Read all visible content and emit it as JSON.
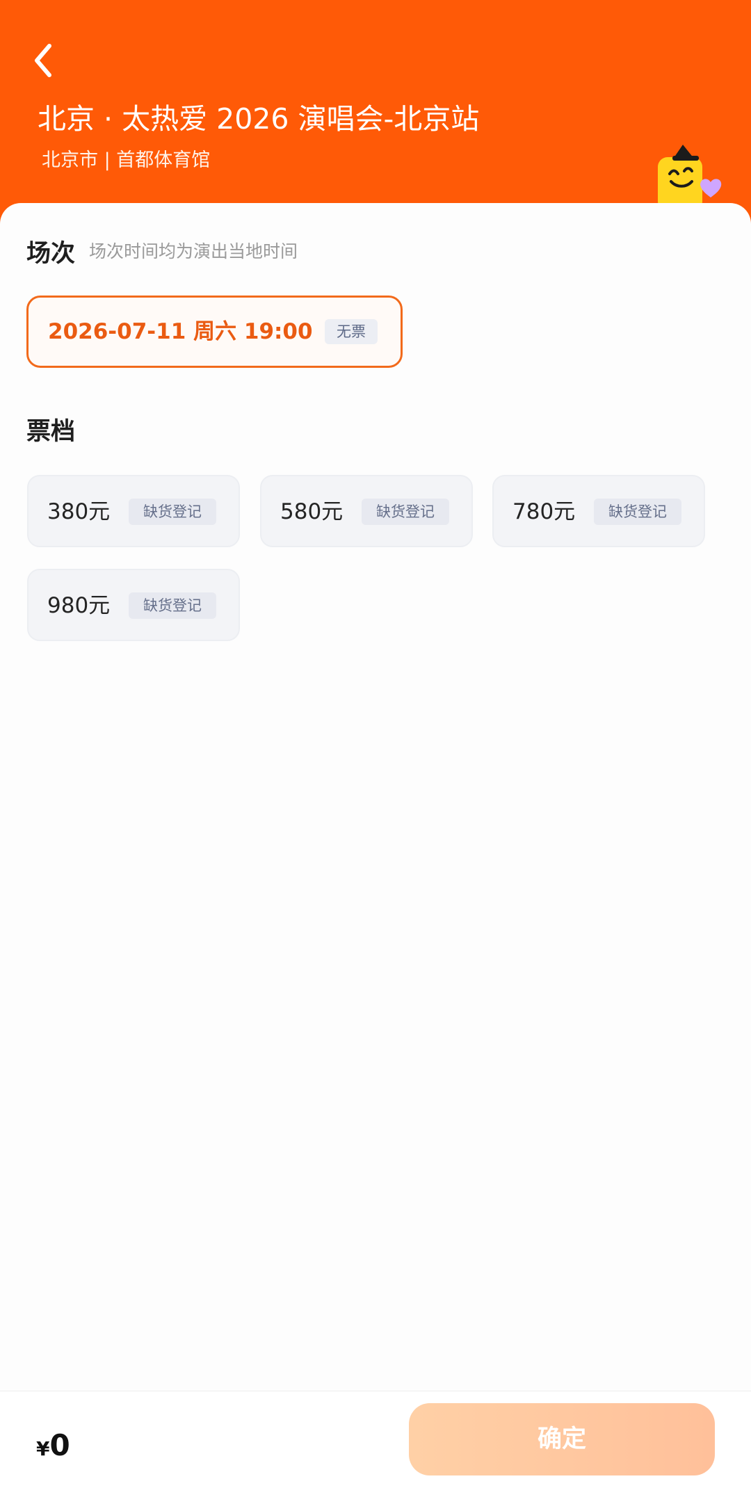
{
  "header": {
    "title": "北京 · 太热爱 2026 演唱会-北京站",
    "venue": "北京市 | 首都体育馆",
    "back_icon": "chevron-left-icon",
    "mascot_icon": "smiley-mascot-icon"
  },
  "sessions": {
    "title": "场次",
    "hint": "场次时间均为演出当地时间",
    "items": [
      {
        "label": "2026-07-11  周六 19:00",
        "status": "无票"
      }
    ]
  },
  "tickets": {
    "title": "票档",
    "items": [
      {
        "price": "380元",
        "status": "缺货登记"
      },
      {
        "price": "580元",
        "status": "缺货登记"
      },
      {
        "price": "780元",
        "status": "缺货登记"
      },
      {
        "price": "980元",
        "status": "缺货登记"
      }
    ]
  },
  "footer": {
    "currency_symbol": "¥",
    "total": "0",
    "confirm_label": "确定"
  },
  "colors": {
    "brand": "#ff5a07",
    "accent": "#ea5b12",
    "button_gradient_start": "#ffd0a6",
    "button_gradient_end": "#ffc09a",
    "badge_text": "#66708b"
  }
}
